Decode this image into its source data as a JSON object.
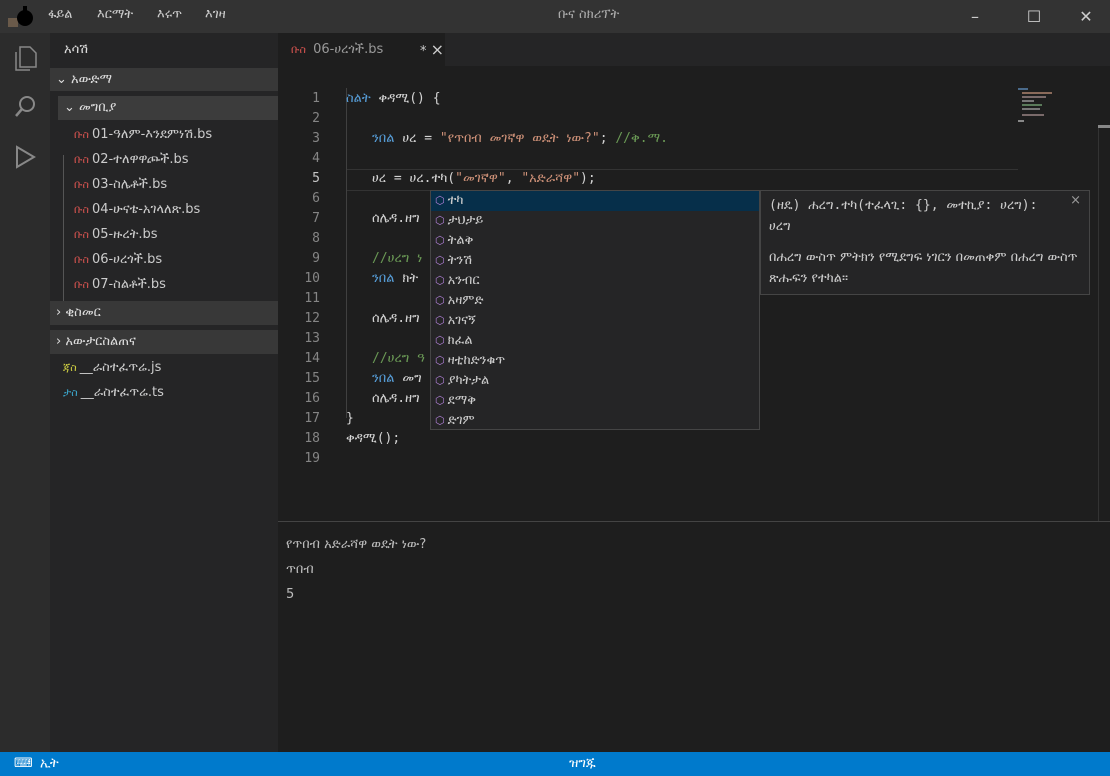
{
  "app": {
    "title": "ቡና ስክሪፕት",
    "menu": [
      "ፋይል",
      "እርማት",
      "እሩጥ",
      "እገዛ"
    ]
  },
  "sidebar": {
    "header": "አሳሽ",
    "workspace": "አውድማ",
    "folder": "መግቢያ",
    "files": [
      {
        "icon": "ቡስ",
        "name": "01-ዓለም-እንደምነሽ.bs"
      },
      {
        "icon": "ቡስ",
        "name": "02-ተለዋዋጮች.bs"
      },
      {
        "icon": "ቡስ",
        "name": "03-ስሌቶች.bs"
      },
      {
        "icon": "ቡስ",
        "name": "04-ሁናቴ-አገላለጽ.bs"
      },
      {
        "icon": "ቡስ",
        "name": "05-ዙረት.bs"
      },
      {
        "icon": "ቡስ",
        "name": "06-ሀረጎች.bs"
      },
      {
        "icon": "ቡስ",
        "name": "07-ስልቶች.bs"
      }
    ],
    "sections": [
      "ቂስመር",
      "አውታርስልጠና"
    ],
    "root_files": [
      {
        "icon": "ጃስ",
        "name": "__ራስተፈጥሬ.js",
        "color": "#cbcb41"
      },
      {
        "icon": "ታስ",
        "name": "__ራስተፈጥሬ.ts",
        "color": "#3ba4c8"
      }
    ]
  },
  "tab": {
    "icon": "ቡስ",
    "name": "06-ሀረጎች.bs",
    "modified": "*",
    "close": "×"
  },
  "editor": {
    "line_numbers": [
      "1",
      "2",
      "3",
      "4",
      "5",
      "6",
      "7",
      "8",
      "9",
      "10",
      "11",
      "12",
      "13",
      "14",
      "15",
      "16",
      "17",
      "18",
      "19"
    ],
    "lines": {
      "l1": {
        "kw": "ስልት",
        "rest": " ቀዳሚ() {"
      },
      "l3": {
        "kw": "ንበል",
        "a": " ሀረ = ",
        "str": "\"የጥበብ መገኛዋ ወዴት ነው?\"",
        "b": "; ",
        "cm": "//ቅ.ማ."
      },
      "l5": {
        "a": "ሀረ = ሀረ.ተካ(",
        "s1": "\"መገኛዋ\"",
        "b": ", ",
        "s2": "\"አድራሻዋ\"",
        "c": ");"
      },
      "l7": "ሰሌዳ.ዘግ",
      "l9": "//ሀረግ ነ",
      "l10": {
        "kw": "ንበል",
        "rest": " ክት"
      },
      "l12": "ሰሌዳ.ዘግ",
      "l14": "//ሀረግ ዓ",
      "l15": {
        "kw": "ንበል",
        "rest": " መግ"
      },
      "l16": "ሰሌዳ.ዘግ",
      "l17": "}",
      "l18": "ቀዳሚ();"
    }
  },
  "suggest": {
    "items": [
      "ተካ",
      "ታህታይ",
      "ትልቅ",
      "ትንሽ",
      "አንብር",
      "አዛምድ",
      "አገናኝ",
      "ክፈል",
      "ዛቲከድንቁጥ",
      "ያካትታል",
      "ደማቅ",
      "ድገም"
    ],
    "selected": 0
  },
  "details": {
    "signature": "(ዘዴ) ሐረግ.ተካ(ተፈላጊ: {}, መተኪያ: ሀረግ): ሀረግ",
    "doc": "በሐረግ ውስጥ ምትክን የሚደግፍ ነገርን በመጠቀም በሐረግ ውስጥ ጽሑፍን የተካል።",
    "close": "×"
  },
  "output": [
    "የጥበብ አድራሻዋ ወዴት ነው?",
    "ጥበብ",
    "5"
  ],
  "status": {
    "language": "ኢት",
    "state": "ዝግጁ",
    "color": "#007acc"
  }
}
